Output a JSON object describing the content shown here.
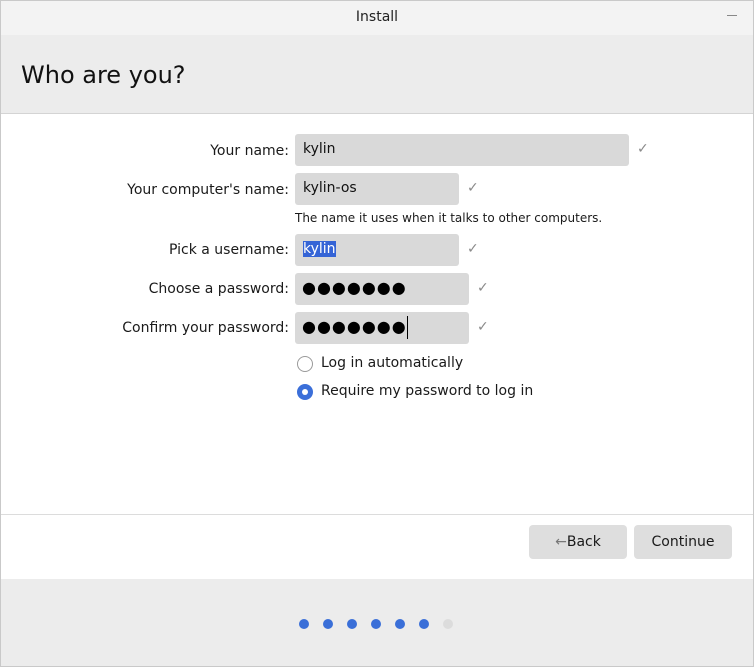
{
  "window": {
    "title": "Install"
  },
  "header": {
    "title": "Who are you?"
  },
  "form": {
    "name": {
      "label": "Your name:",
      "value": "kylin",
      "status": "check"
    },
    "computer_name": {
      "label": "Your computer's name:",
      "value": "kylin-os",
      "hint": "The name it uses when it talks to other computers.",
      "status": "check"
    },
    "username": {
      "label": "Pick a username:",
      "value": "kylin",
      "selected": true,
      "status": "check"
    },
    "password": {
      "label": "Choose a password:",
      "mask": "●●●●●●●",
      "status": "check"
    },
    "confirm": {
      "label": "Confirm your password:",
      "mask": "●●●●●●●",
      "status": "check"
    },
    "login_options": [
      {
        "label": "Log in automatically",
        "checked": false
      },
      {
        "label": "Require my password to log in",
        "checked": true
      }
    ]
  },
  "buttons": {
    "back_label": "Back",
    "back_arrow": "←",
    "continue_label": "Continue"
  },
  "progress": {
    "steps": [
      true,
      true,
      true,
      true,
      true,
      true,
      false
    ]
  },
  "colors": {
    "accent": "#3b6fd9",
    "selection": "#3564d6",
    "field_bg": "#d9d9d9",
    "button_bg": "#dedede"
  }
}
